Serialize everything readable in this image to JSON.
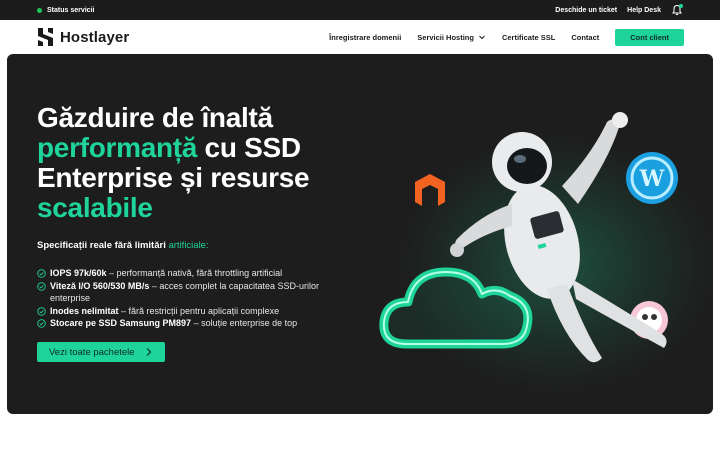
{
  "topbar": {
    "status_label": "Status servicii",
    "ticket_label": "Deschide un ticket",
    "helpdesk_label": "Help Desk"
  },
  "nav": {
    "brand": "Hostlayer",
    "items": [
      {
        "label": "Înregistrare domenii"
      },
      {
        "label": "Servicii Hosting"
      },
      {
        "label": "Certificate SSL"
      },
      {
        "label": "Contact"
      }
    ],
    "cta_label": "Cont client"
  },
  "hero": {
    "headline": {
      "l1": "Găzduire de înaltă",
      "l2_accent": "performanță",
      "l2_rest": " cu SSD",
      "l3": "Enterprise și resurse",
      "l4_accent": "scalabile"
    },
    "specs_title": "Specificații reale fără limitări",
    "specs_title_accent": "artificiale:",
    "features": [
      {
        "bold": "IOPS 97k/60k",
        "accent": "",
        "rest": " – performanță nativă, fără throttling artificial"
      },
      {
        "bold": "Viteză I/O 560/530 MB/s",
        "accent": "",
        "rest": " – acces complet la capacitatea SSD-urilor enterprise"
      },
      {
        "bold": "Inodes nelimitat",
        "accent": "",
        "rest": " – fără restricții pentru aplicații complexe"
      },
      {
        "bold": "Stocare pe SSD Samsung ",
        "accent": "PM897",
        "rest": " – soluție enterprise de top"
      }
    ],
    "cta_label": "Vezi toate pachetele"
  },
  "colors": {
    "accent": "#1fd49a",
    "dark": "#1d1d1d",
    "status_ok": "#22c55e"
  },
  "icons": {
    "status": "status-dot-icon",
    "bell": "bell-icon",
    "chevron": "chevron-down-icon",
    "check": "check-circle-icon",
    "arrow": "chevron-right-icon"
  }
}
